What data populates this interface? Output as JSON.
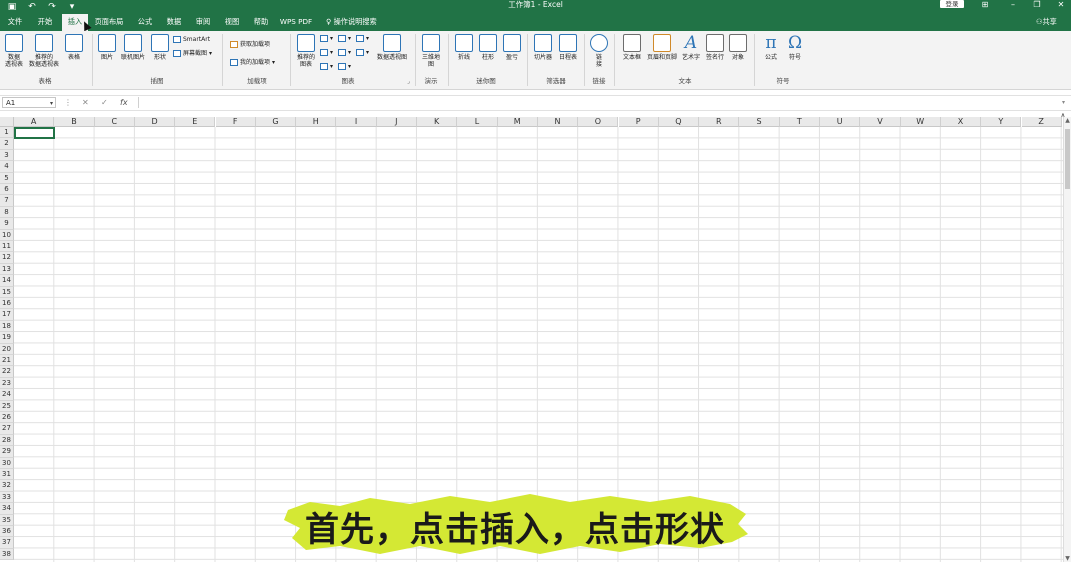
{
  "title_bar": {
    "window_title": "工作簿1 - Excel",
    "login_label": "登录"
  },
  "tabs": [
    "文件",
    "开始",
    "插入",
    "页面布局",
    "公式",
    "数据",
    "审阅",
    "视图",
    "帮助",
    "WPS PDF"
  ],
  "active_tab": "插入",
  "search_label": "操作说明搜索",
  "share_label": "共享",
  "ribbon": {
    "groups": {
      "tables": "表格",
      "illustrations": "插图",
      "addins": "加载项",
      "charts": "图表",
      "tours": "演示",
      "sparklines": "迷你图",
      "filters": "筛选器",
      "links": "链接",
      "text": "文本",
      "symbols": "符号"
    },
    "buttons": {
      "pivot_table_1": "数据",
      "pivot_table_2": "透视表",
      "recommended_pivot_1": "推荐的",
      "recommended_pivot_2": "数据透视表",
      "table": "表格",
      "picture": "图片",
      "online_picture": "联机图片",
      "shapes": "形状",
      "smartart": "SmartArt",
      "screenshot": "屏幕截图",
      "get_addins": "获取加载项",
      "my_addins": "我的加载项",
      "recommended_charts_1": "推荐的",
      "recommended_charts_2": "图表",
      "pivot_chart": "数据透视图",
      "map_3d_1": "三维地",
      "map_3d_2": "图",
      "line": "折线",
      "column": "柱形",
      "winloss": "盈亏",
      "slicer": "切片器",
      "timeline": "日程表",
      "link_1": "链",
      "link_2": "接",
      "textbox": "文本框",
      "header_footer": "页眉和页脚",
      "wordart": "艺术字",
      "signature": "签名行",
      "object": "对象",
      "equation": "公式",
      "symbol": "符号"
    }
  },
  "formula_bar": {
    "name_box": "A1",
    "formula": ""
  },
  "columns": [
    "A",
    "B",
    "C",
    "D",
    "E",
    "F",
    "G",
    "H",
    "I",
    "J",
    "K",
    "L",
    "M",
    "N",
    "O",
    "P",
    "Q",
    "R",
    "S",
    "T",
    "U",
    "V",
    "W",
    "X",
    "Y",
    "Z"
  ],
  "rows": [
    "1",
    "2",
    "3",
    "4",
    "5",
    "6",
    "7",
    "8",
    "9",
    "10",
    "11",
    "12",
    "13",
    "14",
    "15",
    "16",
    "17",
    "18",
    "19",
    "20",
    "21",
    "22",
    "23",
    "24",
    "25",
    "26",
    "27",
    "28",
    "29",
    "30",
    "31",
    "32",
    "33",
    "34",
    "35",
    "36",
    "37",
    "38"
  ],
  "caption": "首先，点击插入，点击形状",
  "colors": {
    "accent": "#217346",
    "caption_highlight": "#d4e834"
  }
}
